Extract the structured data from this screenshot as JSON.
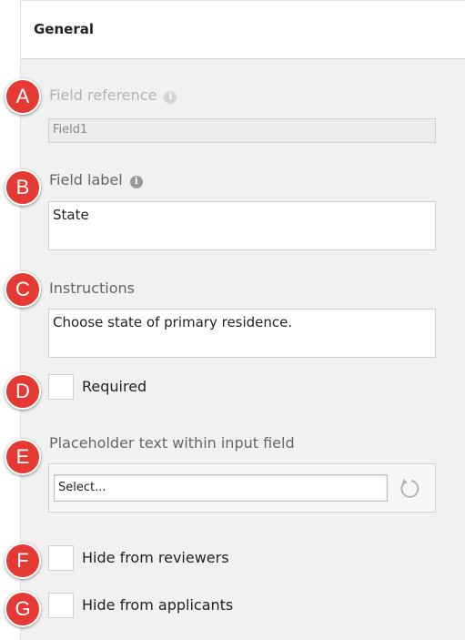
{
  "header": {
    "title": "General"
  },
  "badges": [
    "A",
    "B",
    "C",
    "D",
    "E",
    "F",
    "G"
  ],
  "field_reference": {
    "label": "Field reference",
    "value": "Field1",
    "info_icon": "info-icon"
  },
  "field_label": {
    "label": "Field label",
    "value": "State",
    "info_icon": "info-icon"
  },
  "instructions": {
    "label": "Instructions",
    "value": "Choose state of primary residence."
  },
  "required": {
    "label": "Required",
    "checked": false
  },
  "placeholder": {
    "label": "Placeholder text within input field",
    "value": "Select...",
    "reset_icon": "reset-icon"
  },
  "hide_reviewers": {
    "label": "Hide from reviewers",
    "checked": false
  },
  "hide_applicants": {
    "label": "Hide from applicants",
    "checked": false
  },
  "colors": {
    "badge": "#e53a34",
    "panel": "#f1f1f1"
  }
}
